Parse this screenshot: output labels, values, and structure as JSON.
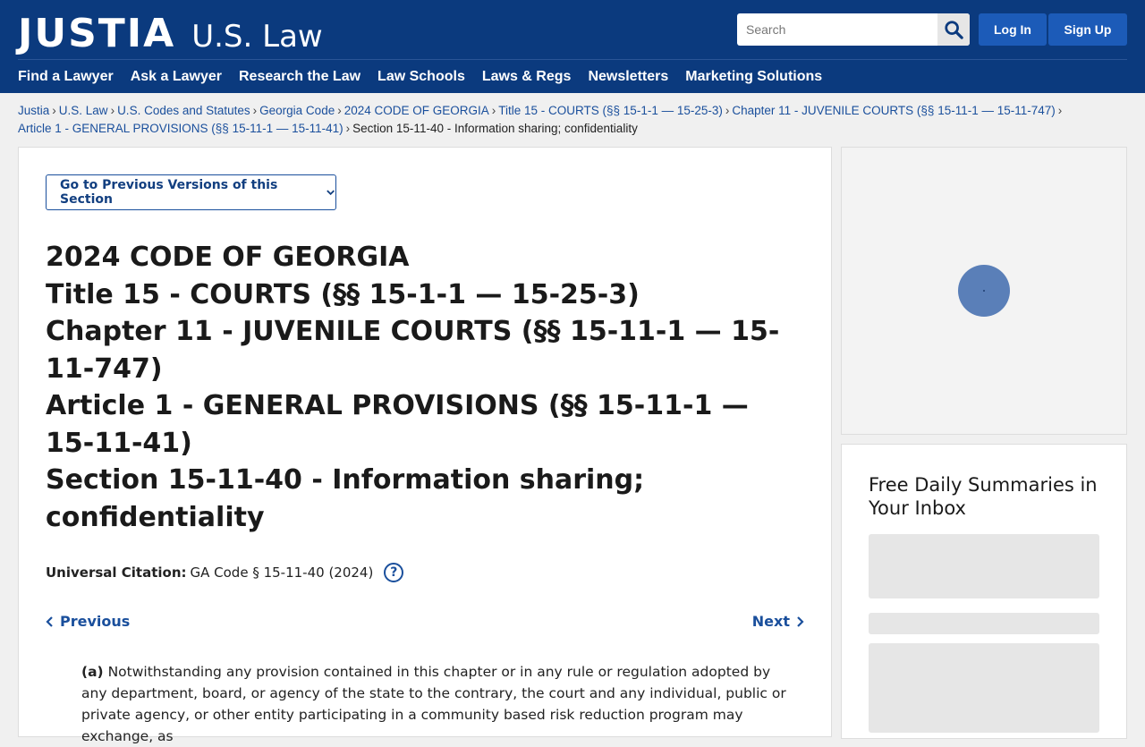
{
  "header": {
    "logo": "JUSTIA",
    "logo_sub": "U.S. Law",
    "search_placeholder": "Search",
    "login_label": "Log In",
    "signup_label": "Sign Up"
  },
  "nav": [
    "Find a Lawyer",
    "Ask a Lawyer",
    "Research the Law",
    "Law Schools",
    "Laws & Regs",
    "Newsletters",
    "Marketing Solutions"
  ],
  "breadcrumb": {
    "links": [
      "Justia",
      "U.S. Law",
      "U.S. Codes and Statutes",
      "Georgia Code",
      "2024 CODE OF GEORGIA",
      "Title 15 - COURTS (§§ 15-1-1 — 15-25-3)",
      "Chapter 11 - JUVENILE COURTS (§§ 15-11-1 — 15-11-747)",
      "Article 1 - GENERAL PROVISIONS (§§ 15-11-1 — 15-11-41)"
    ],
    "current": "Section 15-11-40 - Information sharing; confidentiality",
    "separator": "›"
  },
  "main": {
    "prev_versions_label": "Go to Previous Versions of this Section",
    "title_lines": [
      "2024 CODE OF GEORGIA",
      "Title 15 - COURTS (§§ 15-1-1 — 15-25-3)",
      "Chapter 11 - JUVENILE COURTS (§§ 15-11-1 — 15-11-747)",
      "Article 1 - GENERAL PROVISIONS (§§ 15-11-1 — 15-11-41)",
      "Section 15-11-40 - Information sharing; confidentiality"
    ],
    "citation_label": "Universal Citation:",
    "citation_value": "GA Code § 15-11-40 (2024)",
    "help_glyph": "?",
    "previous_label": "Previous",
    "next_label": "Next",
    "para_marker": "(a)",
    "para_text": "Notwithstanding any provision contained in this chapter or in any rule or regulation adopted by any department, board, or agency of the state to the contrary, the court and any individual, public or private agency, or other entity participating in a community based risk reduction program may exchange, as"
  },
  "sidebar": {
    "newsletter_title": "Free Daily Summaries in Your Inbox"
  },
  "colors": {
    "header_bg": "#0b3a7e",
    "button_bg": "#1c5bb8",
    "link": "#1a4f9c"
  }
}
